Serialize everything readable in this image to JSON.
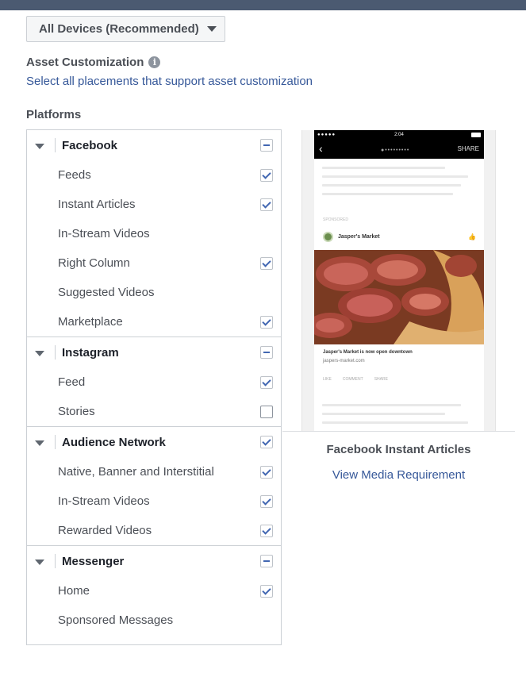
{
  "device_selector": {
    "label": "All Devices (Recommended)"
  },
  "asset_customization": {
    "title": "Asset Customization",
    "info_icon": "info-icon",
    "select_all_link": "Select all placements that support asset customization"
  },
  "platforms": {
    "title": "Platforms",
    "groups": [
      {
        "name": "Facebook",
        "state": "partial",
        "items": [
          {
            "label": "Feeds",
            "state": "checked"
          },
          {
            "label": "Instant Articles",
            "state": "checked"
          },
          {
            "label": "In-Stream Videos",
            "state": "none"
          },
          {
            "label": "Right Column",
            "state": "checked"
          },
          {
            "label": "Suggested Videos",
            "state": "none"
          },
          {
            "label": "Marketplace",
            "state": "checked"
          }
        ]
      },
      {
        "name": "Instagram",
        "state": "partial",
        "items": [
          {
            "label": "Feed",
            "state": "checked"
          },
          {
            "label": "Stories",
            "state": "empty"
          }
        ]
      },
      {
        "name": "Audience Network",
        "state": "checked",
        "items": [
          {
            "label": "Native, Banner and Interstitial",
            "state": "checked"
          },
          {
            "label": "In-Stream Videos",
            "state": "checked"
          },
          {
            "label": "Rewarded Videos",
            "state": "checked"
          }
        ]
      },
      {
        "name": "Messenger",
        "state": "partial",
        "items": [
          {
            "label": "Home",
            "state": "checked"
          },
          {
            "label": "Sponsored Messages",
            "state": "none"
          }
        ]
      }
    ]
  },
  "preview": {
    "phone": {
      "time": "2:04",
      "share_label": "SHARE",
      "sponsored_label": "SPONSORED",
      "advertiser": "Jasper's Market",
      "caption": "Jasper's Market is now open downtown",
      "domain": "jaspers-market.com",
      "actions": [
        "LIKE",
        "COMMENT",
        "SHARE"
      ]
    },
    "title": "Facebook Instant Articles",
    "link": "View Media Requirement"
  },
  "colors": {
    "link": "#365899",
    "checkbox_accent": "#4267b2",
    "topbar": "#4b5a71"
  }
}
